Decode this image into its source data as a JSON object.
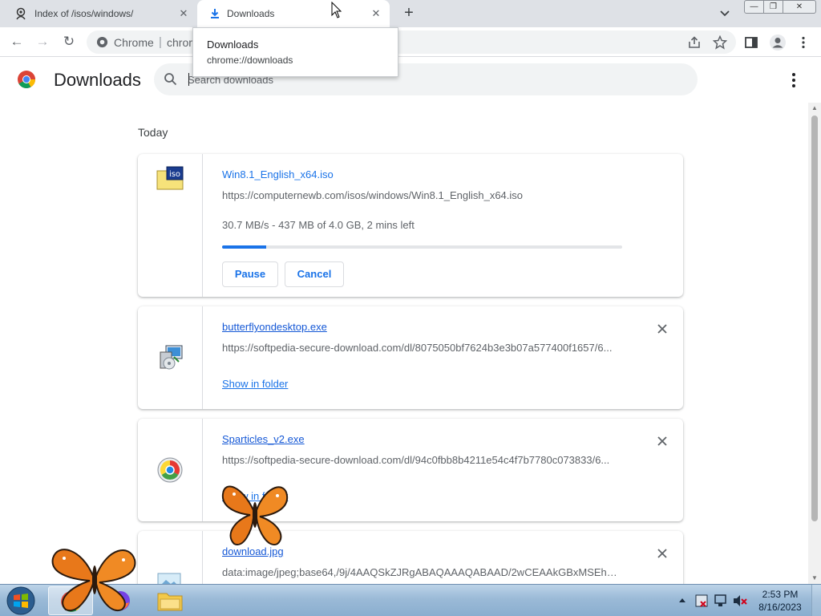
{
  "browser": {
    "tabs": [
      {
        "title": "Index of /isos/windows/",
        "active": false
      },
      {
        "title": "Downloads",
        "active": true
      }
    ],
    "omnibox": {
      "site_label": "Chrome",
      "url_text": "chrome://downloads"
    },
    "hover_card": {
      "title": "Downloads",
      "url": "chrome://downloads"
    }
  },
  "page": {
    "title": "Downloads",
    "search_placeholder": "Search downloads",
    "section_label": "Today"
  },
  "downloads": [
    {
      "file_name": "Win8.1_English_x64.iso",
      "url": "https://computernewb.com/isos/windows/Win8.1_English_x64.iso",
      "status": "30.7 MB/s - 437 MB of 4.0 GB, 2 mins left",
      "progress_percent": 11,
      "pause_label": "Pause",
      "cancel_label": "Cancel",
      "icon": "iso-file-icon"
    },
    {
      "file_name": "butterflyondesktop.exe",
      "url": "https://softpedia-secure-download.com/dl/8075050bf7624b3e3b07a577400f1657/6...",
      "action_label": "Show in folder",
      "icon": "installer-exe-icon"
    },
    {
      "file_name": "Sparticles_v2.exe",
      "url": "https://softpedia-secure-download.com/dl/94c0fbb8b4211e54c4f7b7780c073833/6...",
      "action_label": "Show in folder",
      "icon": "sparticles-exe-icon"
    },
    {
      "file_name": "download.jpg",
      "url": "data:image/jpeg;base64,/9j/4AAQSkZJRgABAQAAAQABAAD/2wCEAAkGBxMSEhUS...",
      "icon": "image-file-icon"
    }
  ],
  "taskbar": {
    "time": "2:53 PM",
    "date": "8/16/2023"
  }
}
